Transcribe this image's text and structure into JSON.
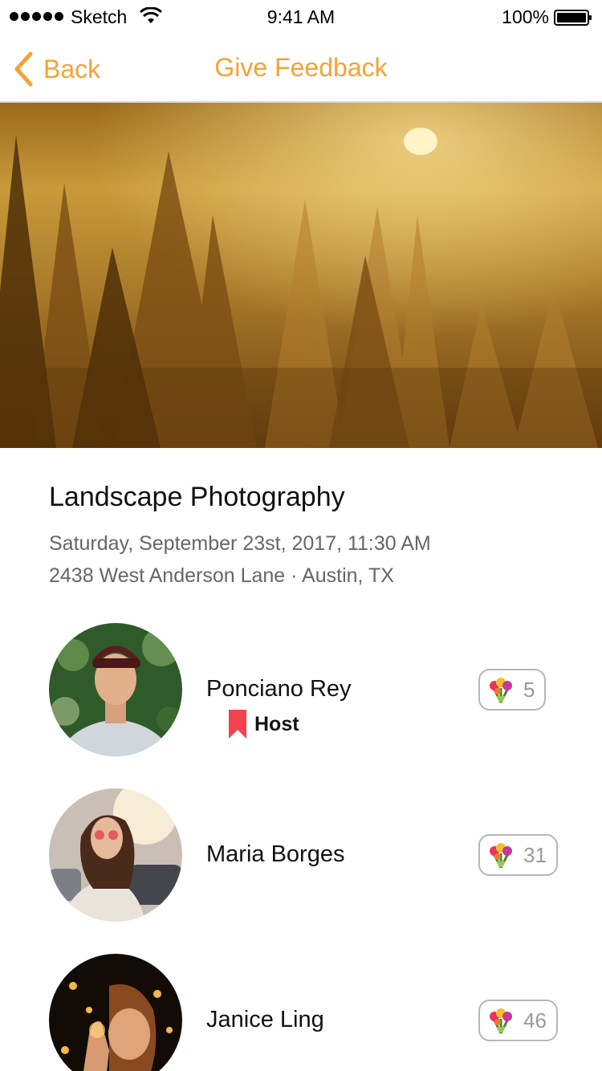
{
  "status_bar": {
    "carrier": "Sketch",
    "time": "9:41 AM",
    "battery": "100%"
  },
  "nav": {
    "back_label": "Back",
    "title": "Give Feedback"
  },
  "event": {
    "title": "Landscape Photography",
    "datetime": "Saturday, September 23st, 2017, 11:30 AM",
    "address": "2438 West Anderson Lane · Austin, TX"
  },
  "people": [
    {
      "name": "Ponciano Rey",
      "role": "Host",
      "flowers": "5"
    },
    {
      "name": "Maria Borges",
      "role": "",
      "flowers": "31"
    },
    {
      "name": "Janice Ling",
      "role": "",
      "flowers": "46"
    }
  ],
  "colors": {
    "accent": "#f5a234",
    "host_ribbon": "#f0434f",
    "secondary_text": "#666666"
  },
  "icons": {
    "back": "chevron-left-icon",
    "flowers": "bouquet-icon",
    "host": "bookmark-ribbon-icon"
  }
}
